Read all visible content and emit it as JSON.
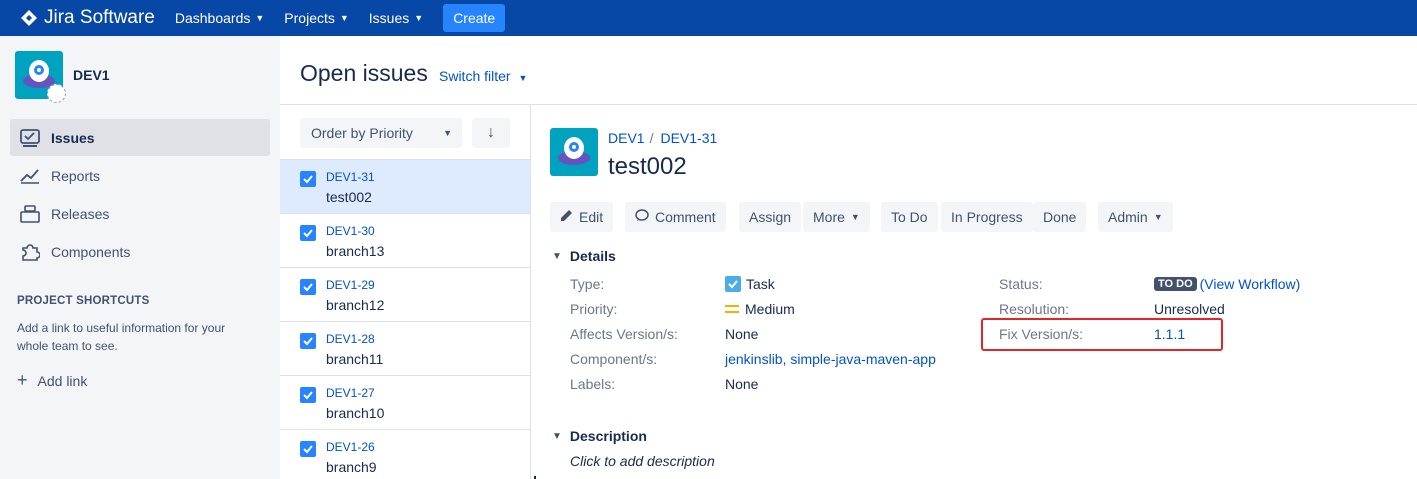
{
  "topnav": {
    "logo_text": "Jira Software",
    "links": [
      "Dashboards",
      "Projects",
      "Issues"
    ],
    "create_label": "Create",
    "colors": {
      "bar": "#0747a6",
      "create": "#2684ff"
    }
  },
  "sidebar": {
    "project_name": "DEV1",
    "items": [
      {
        "label": "Issues",
        "icon": "issues-icon",
        "active": true
      },
      {
        "label": "Reports",
        "icon": "reports-icon",
        "active": false
      },
      {
        "label": "Releases",
        "icon": "releases-icon",
        "active": false
      },
      {
        "label": "Components",
        "icon": "components-icon",
        "active": false
      }
    ],
    "shortcuts_title": "PROJECT SHORTCUTS",
    "shortcuts_text": "Add a link to useful information for your whole team to see.",
    "add_link_label": "Add link"
  },
  "header": {
    "title": "Open issues",
    "switch_filter": "Switch filter"
  },
  "list": {
    "order_label": "Order by Priority",
    "issues": [
      {
        "key": "DEV1-31",
        "summary": "test002",
        "selected": true
      },
      {
        "key": "DEV1-30",
        "summary": "branch13",
        "selected": false
      },
      {
        "key": "DEV1-29",
        "summary": "branch12",
        "selected": false
      },
      {
        "key": "DEV1-28",
        "summary": "branch11",
        "selected": false
      },
      {
        "key": "DEV1-27",
        "summary": "branch10",
        "selected": false
      },
      {
        "key": "DEV1-26",
        "summary": "branch9",
        "selected": false
      }
    ]
  },
  "detail": {
    "breadcrumb_project": "DEV1",
    "breadcrumb_sep": "/",
    "breadcrumb_issue": "DEV1-31",
    "title": "test002",
    "toolbar": {
      "edit": "Edit",
      "comment": "Comment",
      "assign": "Assign",
      "more": "More",
      "todo": "To Do",
      "in_progress": "In Progress",
      "done": "Done",
      "admin": "Admin"
    },
    "details_heading": "Details",
    "fields": {
      "type_label": "Type:",
      "type_value": "Task",
      "priority_label": "Priority:",
      "priority_value": "Medium",
      "affects_label": "Affects Version/s:",
      "affects_value": "None",
      "component_label": "Component/s:",
      "component_value": "jenkinslib, simple-java-maven-app",
      "labels_label": "Labels:",
      "labels_value": "None",
      "status_label": "Status:",
      "status_value": "TO DO",
      "workflow_link": "(View Workflow)",
      "resolution_label": "Resolution:",
      "resolution_value": "Unresolved",
      "fix_label": "Fix Version/s:",
      "fix_value": "1.1.1"
    },
    "description_heading": "Description",
    "description_placeholder": "Click to add description"
  }
}
